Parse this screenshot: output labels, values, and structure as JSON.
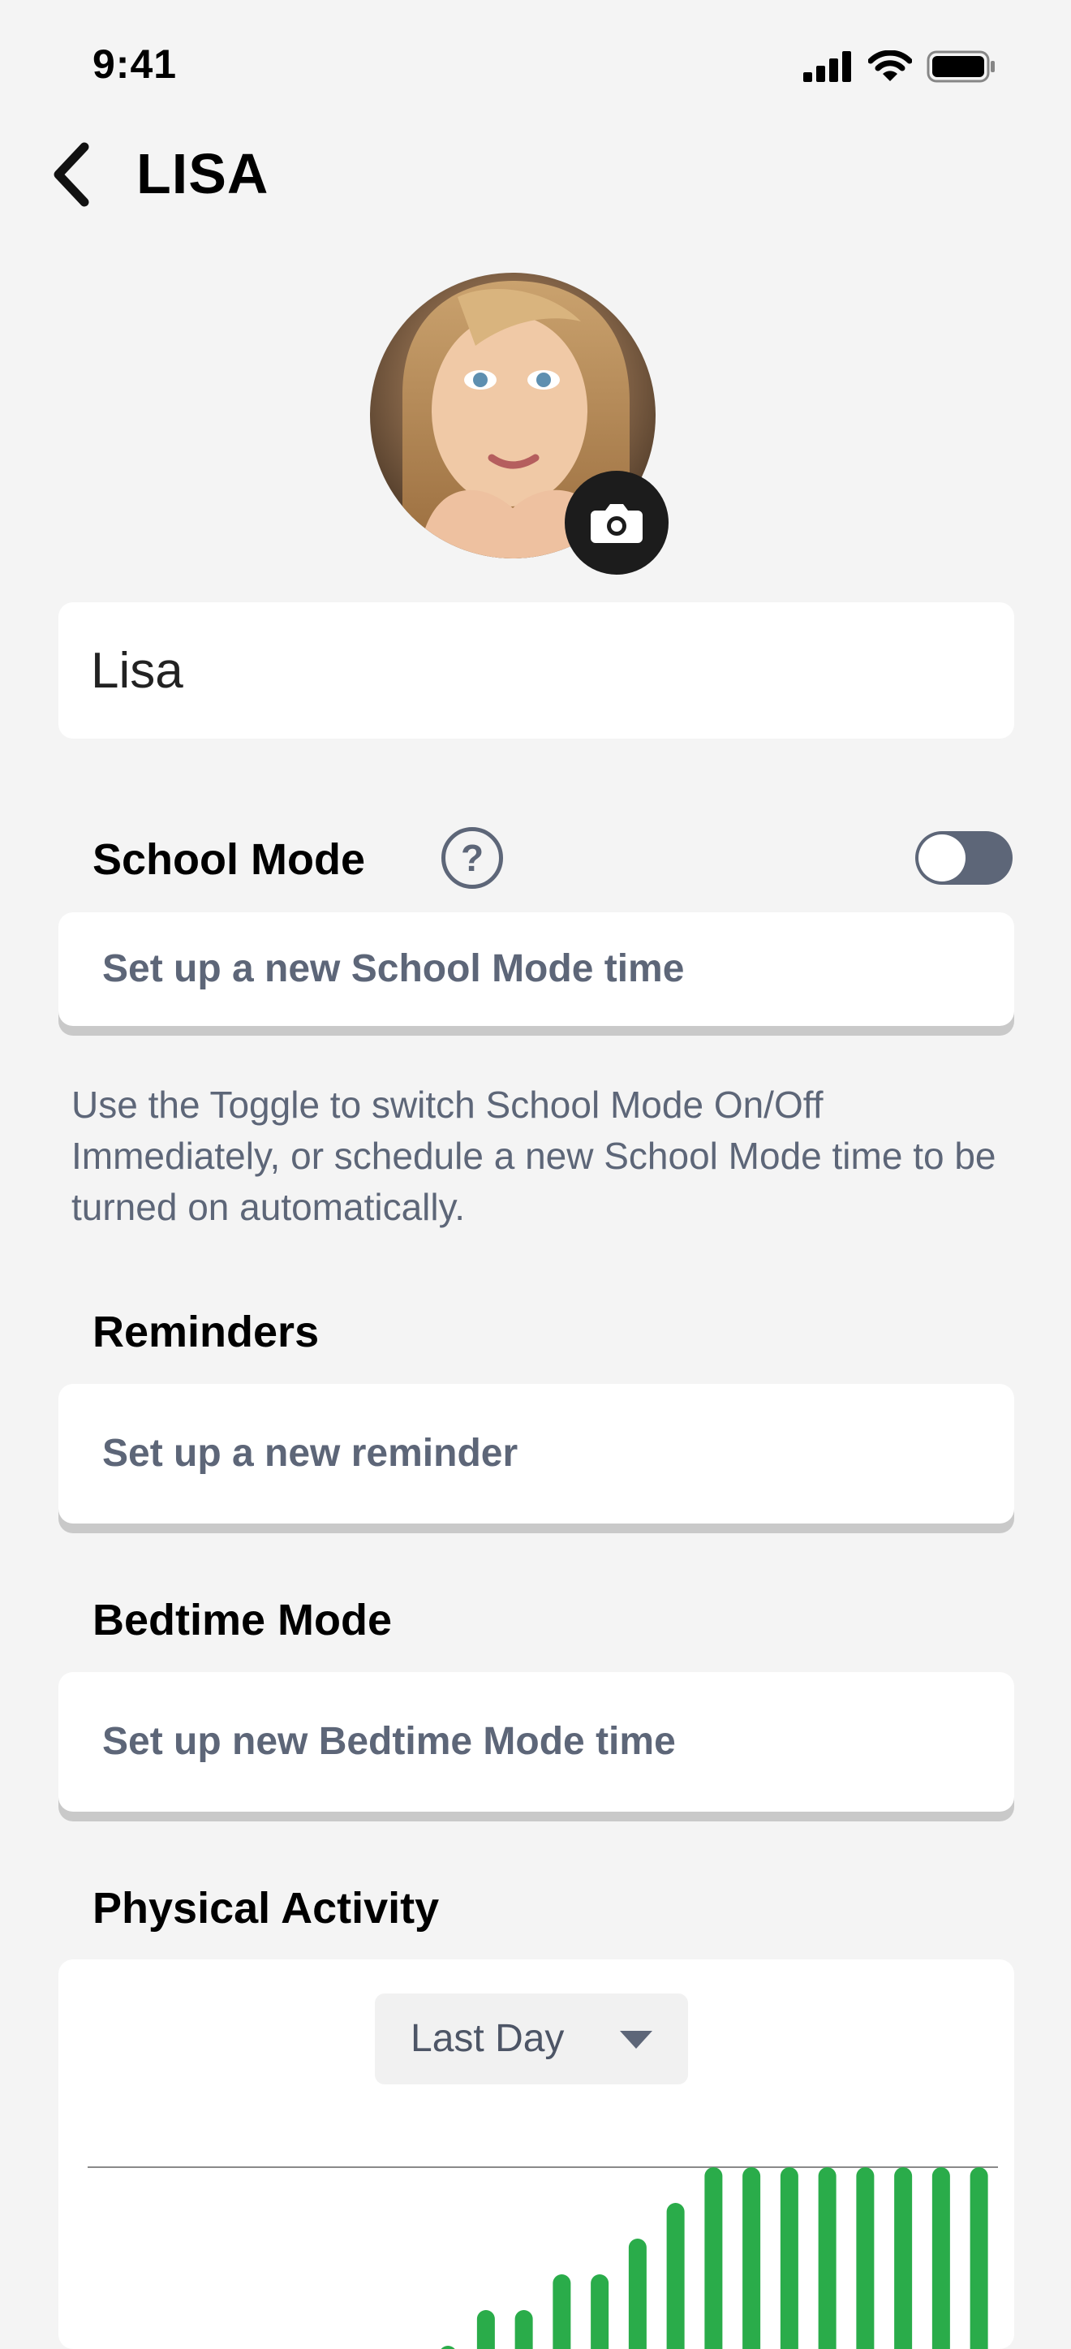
{
  "status_bar": {
    "time": "9:41"
  },
  "nav": {
    "title": "LISA"
  },
  "profile": {
    "name_value": "Lisa"
  },
  "school_mode": {
    "title": "School Mode",
    "help_symbol": "?",
    "toggle_on": false,
    "row_label": "Set up a new School Mode time",
    "helper_text": "Use the Toggle to switch School Mode On/Off Immediately, or schedule a new School Mode time to be turned on automatically."
  },
  "reminders": {
    "title": "Reminders",
    "row_label": "Set up a new reminder"
  },
  "bedtime_mode": {
    "title": "Bedtime Mode",
    "row_label": "Set up new Bedtime Mode time"
  },
  "physical_activity": {
    "title": "Physical Activity",
    "period_selected": "Last Day"
  },
  "colors": {
    "accent_gray": "#5d6678",
    "bar_green": "#2aac4a",
    "background": "#f4f4f4"
  },
  "chart_data": {
    "type": "bar",
    "values": [
      0,
      0,
      0,
      0,
      0,
      0,
      0,
      0,
      0,
      1,
      2,
      2,
      3,
      3,
      4,
      5,
      6,
      6,
      6,
      6,
      6,
      6,
      6,
      6
    ],
    "goal_line": 6,
    "bar_color": "#2aac4a"
  }
}
